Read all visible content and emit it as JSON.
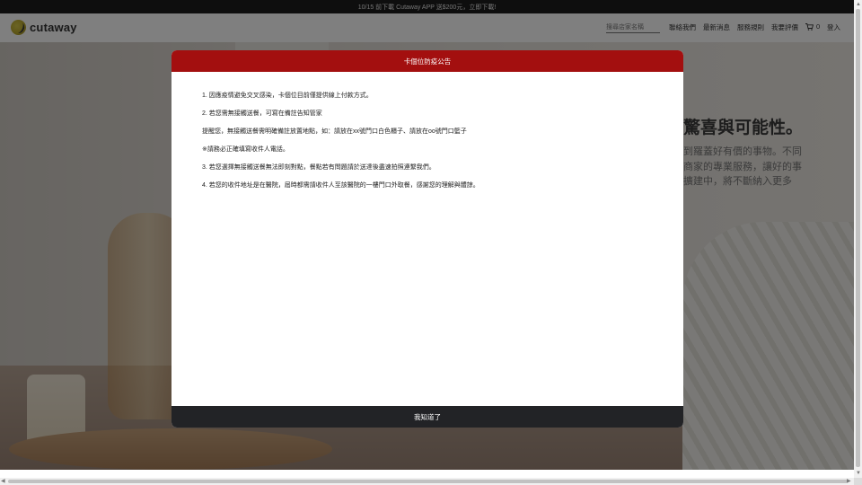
{
  "promo_bar": {
    "text": "10/15 前下載 Cutaway APP 送$200元，立即下載!"
  },
  "header": {
    "logo_text": "cutaway",
    "search_placeholder": "搜尋店家名稱",
    "nav": [
      {
        "label": "聯絡我們"
      },
      {
        "label": "最新消息"
      },
      {
        "label": "服務規則"
      },
      {
        "label": "我要評價"
      }
    ],
    "cart_count": "0",
    "login_label": "登入"
  },
  "hero": {
    "title": "驚喜與可能性。",
    "lines": [
      "到羅蓋好有價的事物。不同",
      "商家的專業服務，讓好的事",
      "擴建中，將不斷納入更多"
    ]
  },
  "modal": {
    "title": "卡個位防疫公告",
    "paragraphs": [
      "1. 因應疫情避免交叉感染，卡個位目前僅提供線上付款方式。",
      "2. 若您需無接觸送餐，可寫在備註告知管家",
      "提醒您，無接觸送餐需明確備註放置地點，如：請放在xx號門口白色櫃子、請放在oo號門口籃子",
      "※請務必正確填寫收件人電話。",
      "3. 若您選擇無接觸送餐無法即刻對點，餐點若有問題請於送達後盡速拍照連繫我們。",
      "4. 若您的收件地址是在醫院，屆時都需請收件人至該醫院的一樓門口外取餐，感謝您的理解與體諒。"
    ],
    "confirm_label": "我知道了"
  },
  "colors": {
    "modal_header": "#a30f0f",
    "modal_footer": "#222326",
    "promo_bar": "#1c1c1c"
  }
}
